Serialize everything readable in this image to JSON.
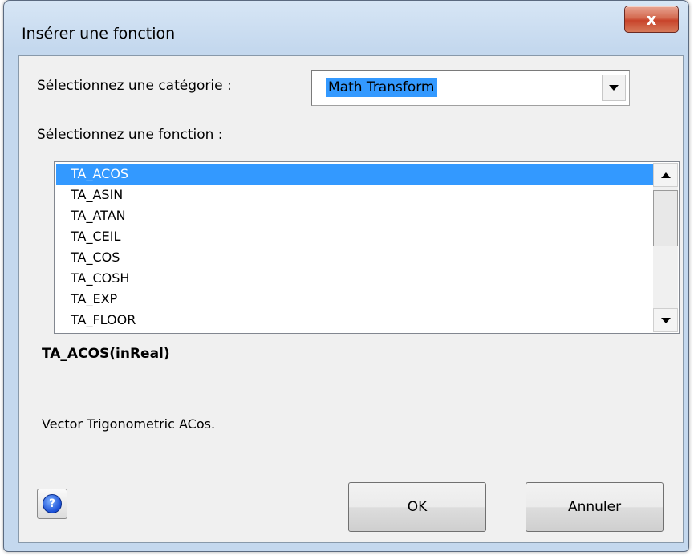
{
  "window": {
    "title": "Insérer une fonction",
    "close_label": "x"
  },
  "category": {
    "label": "Sélectionnez une catégorie :",
    "selected": "Math Transform"
  },
  "function_list": {
    "label": "Sélectionnez une fonction :",
    "items": [
      {
        "label": "TA_ACOS",
        "selected": true
      },
      {
        "label": "TA_ASIN"
      },
      {
        "label": "TA_ATAN"
      },
      {
        "label": "TA_CEIL"
      },
      {
        "label": "TA_COS"
      },
      {
        "label": "TA_COSH"
      },
      {
        "label": "TA_EXP"
      },
      {
        "label": "TA_FLOOR"
      }
    ]
  },
  "details": {
    "signature": "TA_ACOS(inReal)",
    "description": "Vector Trigonometric ACos."
  },
  "buttons": {
    "ok": "OK",
    "cancel": "Annuler",
    "help_icon": "question-mark"
  },
  "colors": {
    "selection": "#3399ff",
    "close_button": "#c8432a"
  }
}
